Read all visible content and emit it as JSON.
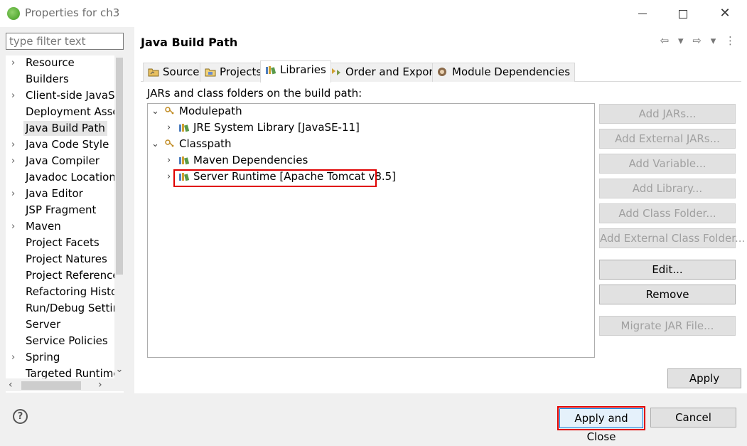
{
  "window": {
    "title": "Properties for ch3",
    "controls": {
      "minimize": "—",
      "maximize": "",
      "close": "✕"
    }
  },
  "sidebar": {
    "filter_placeholder": "type filter text",
    "items": [
      {
        "label": "Resource",
        "expandable": true
      },
      {
        "label": "Builders",
        "expandable": false
      },
      {
        "label": "Client-side JavaSc",
        "expandable": true
      },
      {
        "label": "Deployment Asser",
        "expandable": false
      },
      {
        "label": "Java Build Path",
        "expandable": false,
        "selected": true
      },
      {
        "label": "Java Code Style",
        "expandable": true
      },
      {
        "label": "Java Compiler",
        "expandable": true
      },
      {
        "label": "Javadoc Location",
        "expandable": false
      },
      {
        "label": "Java Editor",
        "expandable": true
      },
      {
        "label": "JSP Fragment",
        "expandable": false
      },
      {
        "label": "Maven",
        "expandable": true
      },
      {
        "label": "Project Facets",
        "expandable": false
      },
      {
        "label": "Project Natures",
        "expandable": false
      },
      {
        "label": "Project Reference",
        "expandable": false
      },
      {
        "label": "Refactoring Histor",
        "expandable": false
      },
      {
        "label": "Run/Debug Settir",
        "expandable": false
      },
      {
        "label": "Server",
        "expandable": false
      },
      {
        "label": "Service Policies",
        "expandable": false
      },
      {
        "label": "Spring",
        "expandable": true
      },
      {
        "label": "Targeted Runtime",
        "expandable": false
      }
    ]
  },
  "main": {
    "title": "Java Build Path",
    "nav_icons": {
      "back": "⇦",
      "back_menu": "▾",
      "forward": "⇨",
      "forward_menu": "▾",
      "more": "⋮"
    },
    "tabs": [
      {
        "label": "Source",
        "icon": "source-folder-icon"
      },
      {
        "label": "Projects",
        "icon": "projects-icon"
      },
      {
        "label": "Libraries",
        "icon": "libraries-icon",
        "active": true
      },
      {
        "label": "Order and Export",
        "icon": "order-export-icon"
      },
      {
        "label": "Module Dependencies",
        "icon": "module-icon"
      }
    ],
    "description": "JARs and class folders on the build path:",
    "tree": [
      {
        "label": "Modulepath",
        "chevron": "⌄",
        "level": 0,
        "icon": "path-icon"
      },
      {
        "label": "JRE System Library [JavaSE-11]",
        "chevron": "›",
        "level": 1,
        "icon": "library-icon"
      },
      {
        "label": "Classpath",
        "chevron": "⌄",
        "level": 0,
        "icon": "path-icon"
      },
      {
        "label": "Maven Dependencies",
        "chevron": "›",
        "level": 1,
        "icon": "library-icon"
      },
      {
        "label": "Server Runtime [Apache Tomcat v8.5]",
        "chevron": "›",
        "level": 1,
        "icon": "library-icon",
        "highlighted": true
      }
    ],
    "buttons": {
      "add_jars": "Add JARs...",
      "add_external_jars": "Add External JARs...",
      "add_variable": "Add Variable...",
      "add_library": "Add Library...",
      "add_class_folder": "Add Class Folder...",
      "add_external_class_folder": "Add External Class Folder...",
      "edit": "Edit...",
      "remove": "Remove",
      "migrate_jar": "Migrate JAR File..."
    },
    "apply": "Apply"
  },
  "footer": {
    "help": "?",
    "apply_and_close": "Apply and Close",
    "cancel": "Cancel"
  },
  "colors": {
    "highlight_border": "#e00000",
    "selection_bg": "#e5e5e5",
    "primary_border": "#0078d7"
  }
}
